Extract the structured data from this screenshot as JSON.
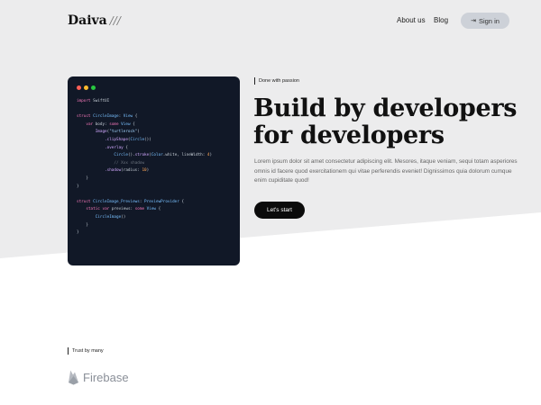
{
  "nav": {
    "logo_text": "Daiva",
    "logo_suffix": "///",
    "links": [
      {
        "label": "About us"
      },
      {
        "label": "Blog"
      }
    ],
    "signin_label": "Sign in"
  },
  "hero": {
    "tag": "Done with passion",
    "headline_line1": "Build by developers",
    "headline_line2": "for developers",
    "lead": "Lorem ipsum dolor sit amet consectetur adipiscing elit. Mesores, itaque veniam, sequi totam asperiores omnis id facere quod exercitationem qui vitae perferendis eveniet! Dignissimos quia dolorum cumque enim cupiditate quod!",
    "cta_label": "Let's start"
  },
  "code_card": {
    "window_dots": [
      "#ff5f57",
      "#febc2e",
      "#28c840"
    ],
    "lines": [
      {
        "indent": "",
        "parts": [
          {
            "t": "import",
            "c": "c-kw"
          },
          {
            "t": " SwiftUI",
            "c": "c-pl"
          }
        ]
      },
      {
        "indent": "",
        "parts": []
      },
      {
        "indent": "",
        "parts": [
          {
            "t": "struct",
            "c": "c-kw"
          },
          {
            "t": " CircleImage",
            "c": "c-ty"
          },
          {
            "t": ": ",
            "c": "c-pl"
          },
          {
            "t": "View",
            "c": "c-ty"
          },
          {
            "t": " {",
            "c": "c-pl"
          }
        ]
      },
      {
        "indent": "    ",
        "parts": [
          {
            "t": "var",
            "c": "c-kw"
          },
          {
            "t": " body: ",
            "c": "c-pl"
          },
          {
            "t": "some",
            "c": "c-kw"
          },
          {
            "t": " View",
            "c": "c-ty"
          },
          {
            "t": " {",
            "c": "c-pl"
          }
        ]
      },
      {
        "indent": "        ",
        "parts": [
          {
            "t": "Image",
            "c": "c-fn"
          },
          {
            "t": "(",
            "c": "c-pl"
          },
          {
            "t": "\"turtlerock\"",
            "c": "c-str"
          },
          {
            "t": ")",
            "c": "c-pl"
          }
        ]
      },
      {
        "indent": "            ",
        "parts": [
          {
            "t": ".clipShape",
            "c": "c-fn"
          },
          {
            "t": "(",
            "c": "c-pl"
          },
          {
            "t": "Circle",
            "c": "c-ty"
          },
          {
            "t": "())",
            "c": "c-pl"
          }
        ]
      },
      {
        "indent": "            ",
        "parts": [
          {
            "t": ".overlay",
            "c": "c-fn"
          },
          {
            "t": " {",
            "c": "c-pl"
          }
        ]
      },
      {
        "indent": "                ",
        "parts": [
          {
            "t": "Circle",
            "c": "c-ty"
          },
          {
            "t": "().",
            "c": "c-pl"
          },
          {
            "t": "stroke",
            "c": "c-fn"
          },
          {
            "t": "(",
            "c": "c-pl"
          },
          {
            "t": "Color",
            "c": "c-ty"
          },
          {
            "t": ".white, lineWidth: ",
            "c": "c-pl"
          },
          {
            "t": "4",
            "c": "c-num"
          },
          {
            "t": ")",
            "c": "c-pl"
          }
        ]
      },
      {
        "indent": "                ",
        "parts": [
          {
            "t": "// Xxx shadow",
            "c": "c-cm"
          }
        ]
      },
      {
        "indent": "            ",
        "parts": [
          {
            "t": ".shadow",
            "c": "c-fn"
          },
          {
            "t": "(radius: ",
            "c": "c-pl"
          },
          {
            "t": "10",
            "c": "c-num"
          },
          {
            "t": ")",
            "c": "c-pl"
          }
        ]
      },
      {
        "indent": "    ",
        "parts": [
          {
            "t": "}",
            "c": "c-pl"
          }
        ]
      },
      {
        "indent": "",
        "parts": [
          {
            "t": "}",
            "c": "c-pl"
          }
        ]
      },
      {
        "indent": "",
        "parts": []
      },
      {
        "indent": "",
        "parts": [
          {
            "t": "struct",
            "c": "c-kw"
          },
          {
            "t": " CircleImage_Previews",
            "c": "c-ty"
          },
          {
            "t": ": ",
            "c": "c-pl"
          },
          {
            "t": "PreviewProvider",
            "c": "c-ty"
          },
          {
            "t": " {",
            "c": "c-pl"
          }
        ]
      },
      {
        "indent": "    ",
        "parts": [
          {
            "t": "static",
            "c": "c-kw"
          },
          {
            "t": " ",
            "c": "c-pl"
          },
          {
            "t": "var",
            "c": "c-kw"
          },
          {
            "t": " previews: ",
            "c": "c-pl"
          },
          {
            "t": "some",
            "c": "c-kw"
          },
          {
            "t": " View",
            "c": "c-ty"
          },
          {
            "t": " {",
            "c": "c-pl"
          }
        ]
      },
      {
        "indent": "        ",
        "parts": [
          {
            "t": "CircleImage",
            "c": "c-ty"
          },
          {
            "t": "()",
            "c": "c-pl"
          }
        ]
      },
      {
        "indent": "    ",
        "parts": [
          {
            "t": "}",
            "c": "c-pl"
          }
        ]
      },
      {
        "indent": "",
        "parts": [
          {
            "t": "}",
            "c": "c-pl"
          }
        ]
      }
    ]
  },
  "trust": {
    "tag": "Trust by many",
    "partners": [
      {
        "name": "Firebase",
        "icon": "firebase-flame-icon"
      }
    ]
  },
  "colors": {
    "hero_bg": "#ececed",
    "page_bg": "#ffffff",
    "code_bg": "#111827",
    "cta_bg": "#0b0b0b",
    "signin_bg": "#cdd1d8"
  }
}
